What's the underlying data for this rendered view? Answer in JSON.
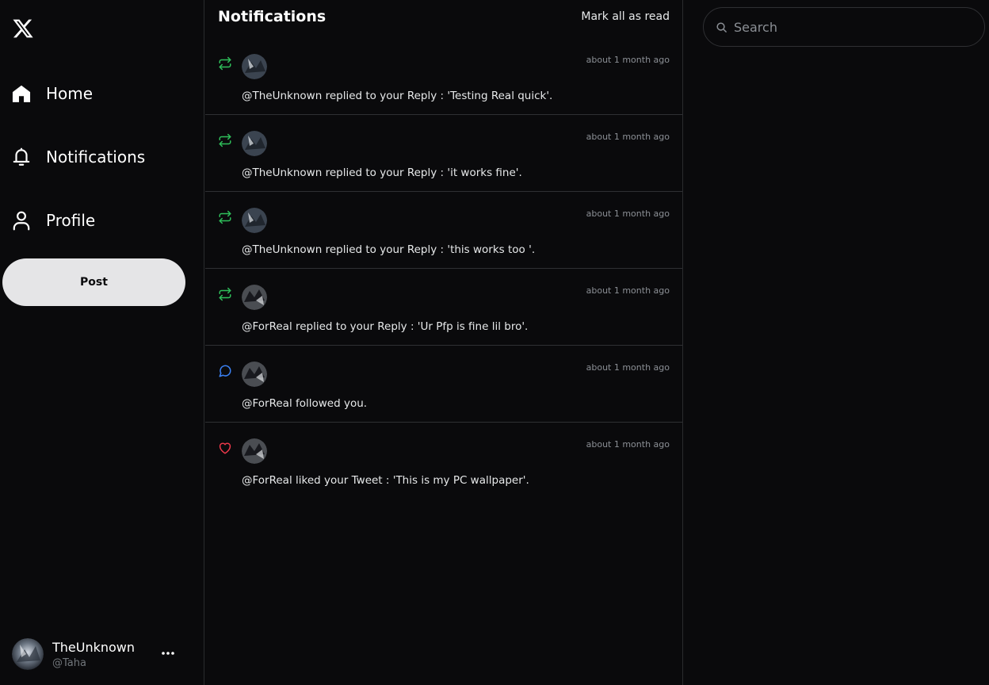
{
  "sidebar": {
    "logo_icon": "x-logo-icon",
    "nav": [
      {
        "label": "Home",
        "icon": "home-icon"
      },
      {
        "label": "Notifications",
        "icon": "bell-icon"
      },
      {
        "label": "Profile",
        "icon": "user-icon"
      }
    ],
    "post_label": "Post",
    "account": {
      "display_name": "TheUnknown",
      "handle": "@Taha"
    }
  },
  "main": {
    "title": "Notifications",
    "mark_all_read": "Mark all as read",
    "notifications": [
      {
        "type": "retweet",
        "icon": "repost-icon",
        "color": "#2fbf5a",
        "timestamp": "about 1 month ago",
        "text": "@TheUnknown replied to your Reply : 'Testing Real quick'."
      },
      {
        "type": "retweet",
        "icon": "repost-icon",
        "color": "#2fbf5a",
        "timestamp": "about 1 month ago",
        "text": "@TheUnknown replied to your Reply : 'it works fine'."
      },
      {
        "type": "retweet",
        "icon": "repost-icon",
        "color": "#2fbf5a",
        "timestamp": "about 1 month ago",
        "text": "@TheUnknown replied to your Reply : 'this works too '."
      },
      {
        "type": "retweet",
        "icon": "repost-icon",
        "color": "#2fbf5a",
        "timestamp": "about 1 month ago",
        "text": "@ForReal replied to your Reply : 'Ur Pfp is fine lil bro'."
      },
      {
        "type": "follow",
        "icon": "comment-icon",
        "color": "#3b82f6",
        "timestamp": "about 1 month ago",
        "text": "@ForReal followed you."
      },
      {
        "type": "like",
        "icon": "heart-icon",
        "color": "#f0394b",
        "timestamp": "about 1 month ago",
        "text": "@ForReal liked your Tweet : 'This is my PC wallpaper'."
      }
    ]
  },
  "right": {
    "search_placeholder": "Search"
  },
  "colors": {
    "background": "#0a0a0c",
    "divider": "#2f3033",
    "post_button": "#e5e5e7"
  }
}
